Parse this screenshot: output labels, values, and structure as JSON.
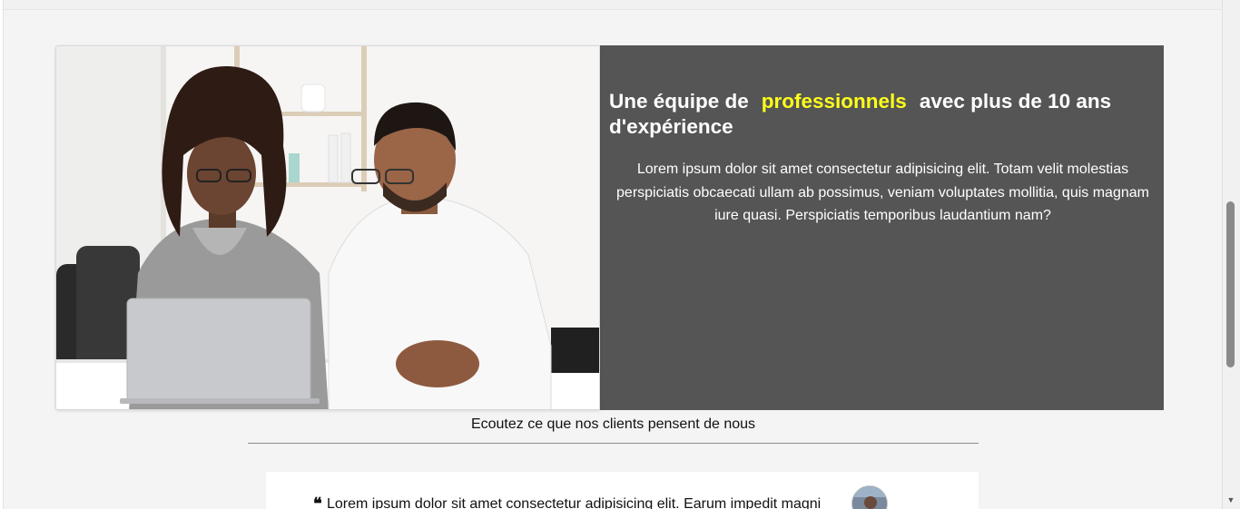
{
  "feature": {
    "title_before": "Une équipe de",
    "title_highlight": "professionnels",
    "title_after": "avec plus de 10 ans d'expérience",
    "paragraph": "Lorem ipsum dolor sit amet consectetur adipisicing elit. Totam velit molestias perspiciatis obcaecati ullam ab possimus, veniam voluptates mollitia, quis magnam iure quasi. Perspiciatis temporibus laudantium nam?",
    "panel_color": "#555555",
    "highlight_color": "#ffff1a"
  },
  "testimonials": {
    "heading": "Ecoutez ce que nos clients pensent de nous",
    "quote_icon": "quote-left-icon",
    "items": [
      {
        "text": "Lorem ipsum  dolor sit amet consectetur adipisicing elit. Earum impedit magni"
      }
    ]
  },
  "scrollbar": {
    "down_icon": "scroll-down-arrow-icon"
  }
}
